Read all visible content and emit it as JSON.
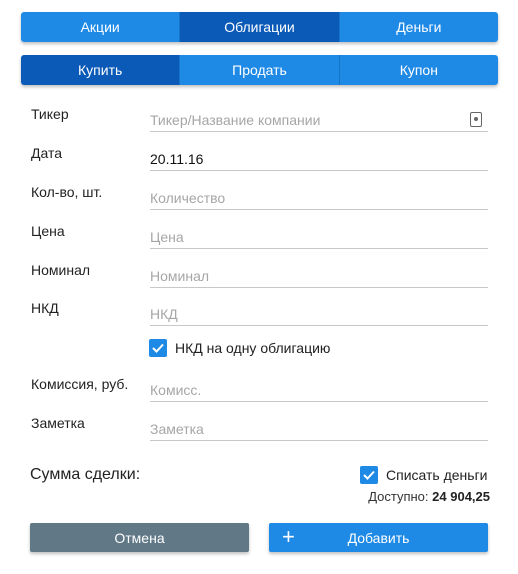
{
  "asset_tabs": [
    {
      "label": "Акции",
      "active": false
    },
    {
      "label": "Облигации",
      "active": true
    },
    {
      "label": "Деньги",
      "active": false
    }
  ],
  "operation_tabs": [
    {
      "label": "Купить",
      "active": true
    },
    {
      "label": "Продать",
      "active": false
    },
    {
      "label": "Купон",
      "active": false
    }
  ],
  "form": {
    "ticker": {
      "label": "Тикер",
      "value": "",
      "placeholder": "Тикер/Название компании"
    },
    "date": {
      "label": "Дата",
      "value": "20.11.16",
      "placeholder": ""
    },
    "quantity": {
      "label": "Кол-во, шт.",
      "value": "",
      "placeholder": "Количество"
    },
    "price": {
      "label": "Цена",
      "value": "",
      "placeholder": "Цена"
    },
    "nominal": {
      "label": "Номинал",
      "value": "",
      "placeholder": "Номинал"
    },
    "nkd": {
      "label": "НКД",
      "value": "",
      "placeholder": "НКД"
    },
    "nkd_per_bond": {
      "label": "НКД на одну облигацию",
      "checked": true
    },
    "commission": {
      "label": "Комиссия, руб.",
      "value": "",
      "placeholder": "Комисс."
    },
    "note": {
      "label": "Заметка",
      "value": "",
      "placeholder": "Заметка"
    }
  },
  "summary": {
    "sum_label": "Сумма сделки:",
    "write_off_label": "Списать деньги",
    "write_off_checked": true,
    "available_label": "Доступно:",
    "available_value": "24 904,25"
  },
  "buttons": {
    "cancel_label": "Отмена",
    "add_label": "Добавить",
    "add_icon": "plus-icon"
  },
  "colors": {
    "accent": "#1e8ae6",
    "accent_active": "#0b5ab8",
    "cancel": "#617887"
  }
}
